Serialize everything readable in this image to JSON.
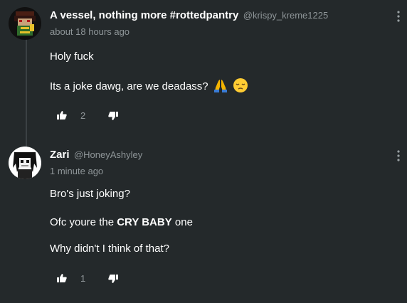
{
  "comments": [
    {
      "author": "A vessel, nothing more #rottedpantry",
      "handle": "@krispy_kreme1225",
      "time": "about 18 hours ago",
      "body": {
        "line1": "Holy fuck",
        "line2": "Its a joke dawg, are we deadass?"
      },
      "emojis": [
        "folded-hands-emoji",
        "pensive-face-emoji"
      ],
      "likes": "2"
    },
    {
      "author": "Zari",
      "handle": "@HoneyAshyley",
      "time": "1 minute ago",
      "body": {
        "line1": "Bro's just joking?",
        "line2_before": "Ofc youre the ",
        "line2_bold": "CRY BABY",
        "line2_after": " one",
        "line3": "Why didn't I think of that?"
      },
      "likes": "1"
    }
  ],
  "colors": {
    "background": "#24292b",
    "text": "#ffffff",
    "muted": "#8f9699",
    "thread_line": "#3b4144"
  }
}
